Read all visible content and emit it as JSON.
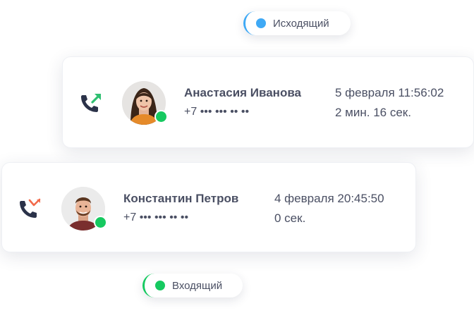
{
  "legend": {
    "outgoing": {
      "label": "Исходящий",
      "color": "#3fa9f5",
      "icon": "outgoing-dot"
    },
    "incoming": {
      "label": "Входящий",
      "color": "#16c960",
      "icon": "incoming-dot"
    }
  },
  "calls": [
    {
      "direction": "outgoing",
      "icon": "phone-outgoing-icon",
      "name": "Анастасия Иванова",
      "phone": "+7 ••• ••• •• ••",
      "datetime": "5 февраля 11:56:02",
      "duration": "2 мин. 16 сек.",
      "online": true
    },
    {
      "direction": "missed",
      "icon": "phone-missed-icon",
      "name": "Константин Петров",
      "phone": "+7 ••• ••• •• ••",
      "datetime": "4 февраля 20:45:50",
      "duration": "0 сек.",
      "online": true
    }
  ],
  "colors": {
    "outgoing_arrow": "#2fbf71",
    "missed_arrow": "#f26a4b",
    "phone_icon": "#2b3249",
    "online": "#16c960"
  }
}
